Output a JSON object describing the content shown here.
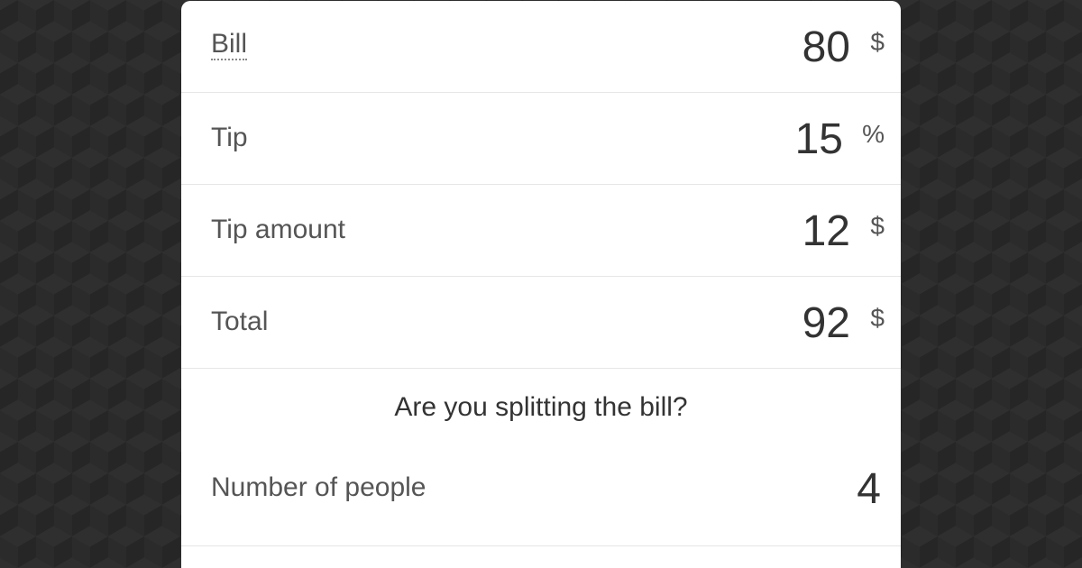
{
  "calculator": {
    "bill": {
      "label": "Bill",
      "value": "80",
      "unit": "$"
    },
    "tip": {
      "label": "Tip",
      "value": "15",
      "unit": "%"
    },
    "tip_amount": {
      "label": "Tip amount",
      "value": "12",
      "unit": "$"
    },
    "total": {
      "label": "Total",
      "value": "92",
      "unit": "$"
    },
    "split": {
      "question": "Are you splitting the bill?",
      "people_label": "Number of people",
      "people_value": "4"
    }
  },
  "colors": {
    "background": "#262626",
    "card": "#ffffff",
    "text": "#333333",
    "label": "#555555",
    "divider": "#e6e6e6"
  }
}
